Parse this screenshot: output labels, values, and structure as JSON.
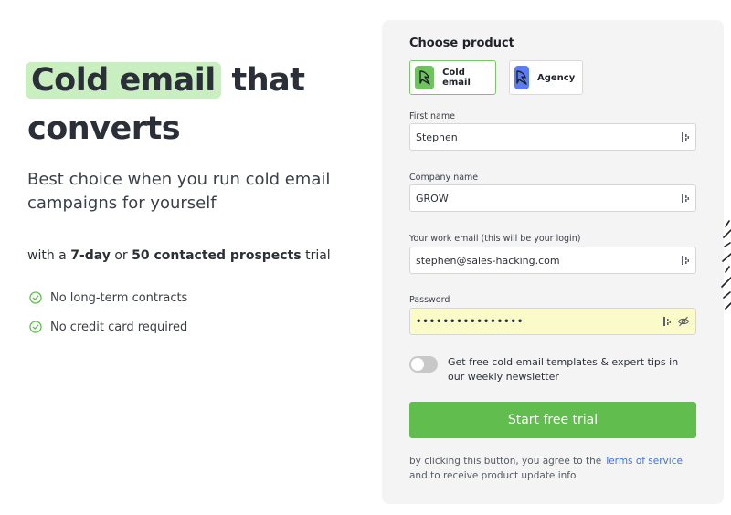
{
  "hero": {
    "headline_highlight": "Cold email",
    "headline_rest_1": " that",
    "headline_rest_2": "converts",
    "subtitle": "Best choice when you run cold email campaigns for yourself",
    "trial_prefix": "with a ",
    "trial_days": "7-day",
    "trial_or": " or ",
    "trial_prospects": "50 contacted prospects",
    "trial_suffix": " trial",
    "features": [
      "No long-term contracts",
      "No credit card required"
    ]
  },
  "form": {
    "title": "Choose product",
    "products": [
      {
        "label": "Cold email",
        "selected": true
      },
      {
        "label": "Agency",
        "selected": false
      }
    ],
    "first_name": {
      "label": "First name",
      "value": "Stephen"
    },
    "company": {
      "label": "Company name",
      "value": "GROW"
    },
    "email": {
      "label": "Your work email (this will be your login)",
      "value": "stephen@sales-hacking.com"
    },
    "password": {
      "label": "Password",
      "value": "••••••••••••••••"
    },
    "newsletter": {
      "label": "Get free cold email templates & expert tips in our weekly newsletter",
      "enabled": false
    },
    "submit_label": "Start free trial",
    "legal_prefix": "by clicking this button, you agree to the ",
    "legal_link": "Terms of service",
    "legal_suffix": " and to receive product update info"
  },
  "colors": {
    "brand_green": "#62bd4f",
    "highlight": "#c9eec0",
    "agency_blue": "#5b7cf0",
    "link": "#3f73d6",
    "password_bg": "#fbfbc9"
  },
  "icons": [
    "check-circle-icon",
    "cold-email-logo-icon",
    "agency-logo-icon",
    "password-manager-icon",
    "eye-slash-icon"
  ]
}
